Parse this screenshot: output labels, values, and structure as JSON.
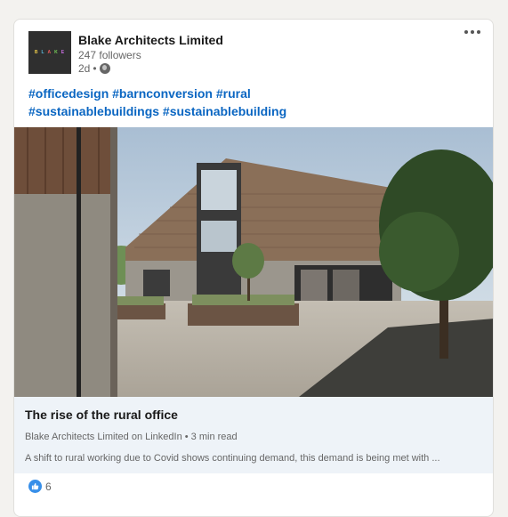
{
  "post": {
    "company_name": "Blake Architects Limited",
    "followers": "247 followers",
    "age": "2d",
    "visibility_icon": "globe-icon",
    "logo_letters": [
      "B",
      "L",
      "A",
      "K",
      "E"
    ],
    "logo_colors": [
      "#e8c84a",
      "#5cc2e8",
      "#e85a5a",
      "#7ad35b",
      "#c96de0"
    ]
  },
  "hashtags": [
    "#officedesign",
    "#barnconversion",
    "#rural",
    "#sustainablebuildings",
    "#sustainablebuilding"
  ],
  "article": {
    "title": "The rise of the rural office",
    "source": "Blake Architects Limited on LinkedIn • 3 min read",
    "description": "A shift to rural working due to Covid shows continuing demand, this demand is being met with ..."
  },
  "reactions": {
    "icon": "like-icon",
    "count": "6"
  }
}
